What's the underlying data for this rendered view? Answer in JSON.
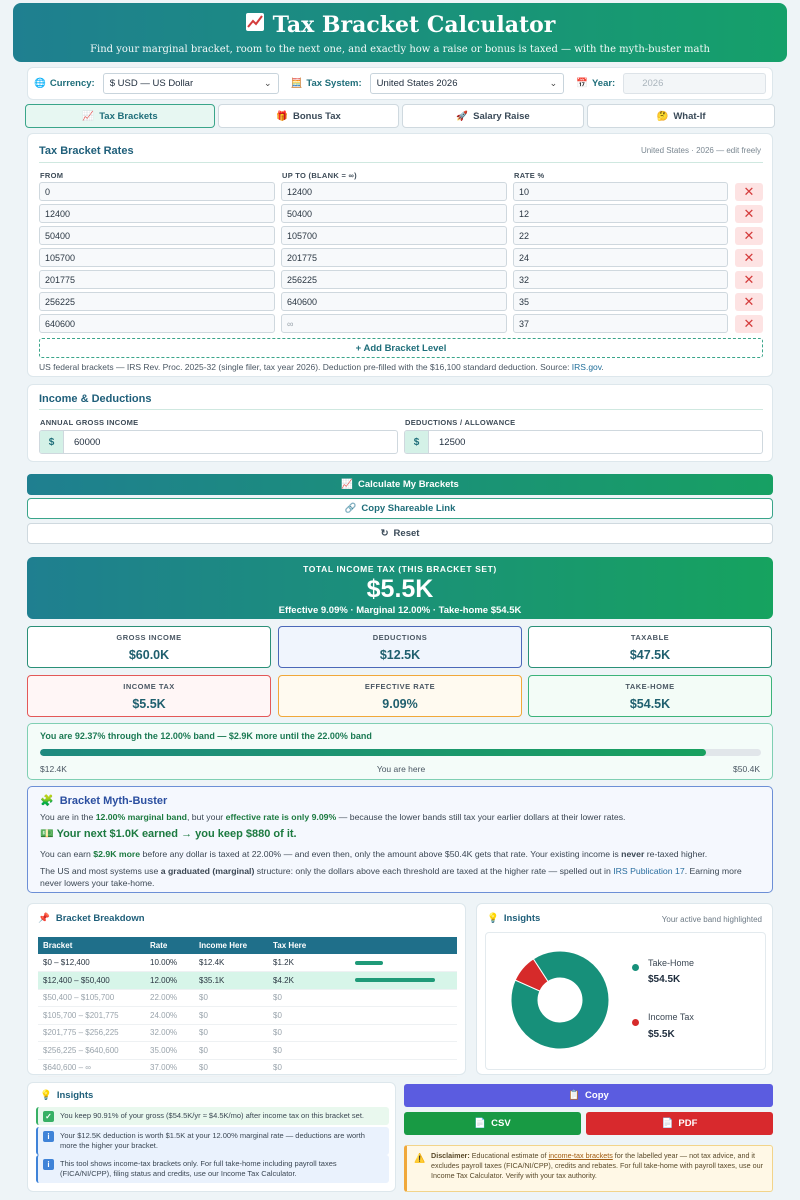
{
  "header": {
    "title": "Tax Bracket Calculator",
    "subtitle": "Find your marginal bracket, room to the next one, and exactly how a raise or bonus is taxed — with the myth-buster math"
  },
  "settings": {
    "currency_label": "Currency:",
    "currency_value": "$ USD — US Dollar",
    "tax_system_label": "Tax System:",
    "tax_system_value": "United States 2026",
    "year_label": "Year:",
    "year_value": "2026"
  },
  "tabs": [
    {
      "label": "Tax Brackets",
      "active": true
    },
    {
      "label": "Bonus Tax",
      "active": false
    },
    {
      "label": "Salary Raise",
      "active": false
    },
    {
      "label": "What-If",
      "active": false
    }
  ],
  "brackets": {
    "title": "Tax Bracket Rates",
    "meta": "United States · 2026 — edit freely",
    "col_from": "FROM",
    "col_upto": "UP TO (BLANK = ∞)",
    "col_rate": "RATE %",
    "rows": [
      {
        "from": "0",
        "upto": "12400",
        "rate": "10"
      },
      {
        "from": "12400",
        "upto": "50400",
        "rate": "12"
      },
      {
        "from": "50400",
        "upto": "105700",
        "rate": "22"
      },
      {
        "from": "105700",
        "upto": "201775",
        "rate": "24"
      },
      {
        "from": "201775",
        "upto": "256225",
        "rate": "32"
      },
      {
        "from": "256225",
        "upto": "640600",
        "rate": "35"
      },
      {
        "from": "640600",
        "upto": "",
        "rate": "37"
      }
    ],
    "upto_placeholder": "∞",
    "add_label": "+ Add Bracket Level",
    "note": "US federal brackets — IRS Rev. Proc. 2025-32 (single filer, tax year 2026). Deduction pre-filled with the $16,100 standard deduction. Source: ",
    "note_link": "IRS.gov",
    "note_end": "."
  },
  "income": {
    "title": "Income & Deductions",
    "gross_label": "ANNUAL GROSS INCOME",
    "gross_prefix": "$",
    "gross_value": "60000",
    "ded_label": "DEDUCTIONS / ALLOWANCE",
    "ded_prefix": "$",
    "ded_value": "12500"
  },
  "actions": {
    "calculate": "Calculate My Brackets",
    "copy_link": "Copy Shareable Link",
    "reset": "Reset"
  },
  "total": {
    "caption": "TOTAL INCOME TAX (THIS BRACKET SET)",
    "amount": "$5.5K",
    "line": "Effective 9.09% · Marginal 12.00% · Take-home $54.5K"
  },
  "stats": {
    "gross_label": "GROSS INCOME",
    "gross_value": "$60.0K",
    "ded_label": "DEDUCTIONS",
    "ded_value": "$12.5K",
    "taxable_label": "TAXABLE",
    "taxable_value": "$47.5K",
    "tax_label": "INCOME TAX",
    "tax_value": "$5.5K",
    "eff_label": "EFFECTIVE RATE",
    "eff_value": "9.09%",
    "home_label": "TAKE-HOME",
    "home_value": "$54.5K"
  },
  "progress": {
    "message": "You are 92.37% through the 12.00% band — $2.9K more until the 22.00% band",
    "fraction": 0.9237,
    "left": "$12.4K",
    "middle": "You are here",
    "right": "$50.4K"
  },
  "myth": {
    "title": "Bracket Myth-Buster",
    "p1_a": "You are in the ",
    "p1_b": "12.00% marginal band",
    "p1_c": ", but your ",
    "p1_d": "effective rate is only 9.09%",
    "p1_e": " — because the lower bands still tax your earlier dollars at their lower rates.",
    "big": "Your next $1.0K earned → you keep $880 of it.",
    "p2_a": "You can earn ",
    "p2_b": "$2.9K more",
    "p2_c": " before any dollar is taxed at 22.00% — and even then, only the amount above $50.4K gets that rate. Your existing income is ",
    "p2_d": "never",
    "p2_e": " re-taxed higher.",
    "p3_a": "The US and most systems use ",
    "p3_b": "a graduated (marginal)",
    "p3_c": " structure: only the dollars above each threshold are taxed at the higher rate — spelled out in ",
    "p3_d": "IRS Publication 17",
    "p3_e": ". Earning more never lowers your take-home."
  },
  "breakdown": {
    "title": "Bracket Breakdown",
    "headers": [
      "Bracket",
      "Rate",
      "Income Here",
      "Tax Here",
      ""
    ],
    "rows": [
      {
        "bracket": "$0 – $12,400",
        "rate": "10.00%",
        "income": "$12.4K",
        "tax": "$1.2K",
        "bar": 0.35,
        "state": "normal"
      },
      {
        "bracket": "$12,400 – $50,400",
        "rate": "12.00%",
        "income": "$35.1K",
        "tax": "$4.2K",
        "bar": 1.0,
        "state": "hit"
      },
      {
        "bracket": "$50,400 – $105,700",
        "rate": "22.00%",
        "income": "$0",
        "tax": "$0",
        "bar": 0,
        "state": "dim"
      },
      {
        "bracket": "$105,700 – $201,775",
        "rate": "24.00%",
        "income": "$0",
        "tax": "$0",
        "bar": 0,
        "state": "dim"
      },
      {
        "bracket": "$201,775 – $256,225",
        "rate": "32.00%",
        "income": "$0",
        "tax": "$0",
        "bar": 0,
        "state": "dim"
      },
      {
        "bracket": "$256,225 – $640,600",
        "rate": "35.00%",
        "income": "$0",
        "tax": "$0",
        "bar": 0,
        "state": "dim"
      },
      {
        "bracket": "$640,600 – ∞",
        "rate": "37.00%",
        "income": "$0",
        "tax": "$0",
        "bar": 0,
        "state": "dim"
      }
    ]
  },
  "insights_chart": {
    "title": "Insights",
    "meta": "Your active band highlighted",
    "take_home_label": "Take-Home",
    "take_home_value": "$54.5K",
    "tax_label": "Income Tax",
    "tax_value": "$5.5K",
    "colors": {
      "take_home": "#17907a",
      "tax": "#d62a2a"
    }
  },
  "chart_data": {
    "type": "pie",
    "categories": [
      "Take-Home",
      "Income Tax"
    ],
    "values": [
      54.5,
      5.5
    ],
    "title": "",
    "xlabel": "",
    "ylabel": ""
  },
  "insights_list": {
    "title": "Insights",
    "items": [
      {
        "kind": "ok",
        "text": "You keep 90.91% of your gross ($54.5K/yr ≈ $4.5K/mo) after income tax on this bracket set."
      },
      {
        "kind": "info",
        "text": "Your $12.5K deduction is worth $1.5K at your 12.00% marginal rate — deductions are worth more the higher your bracket."
      },
      {
        "kind": "info",
        "text": "This tool shows income-tax brackets only. For full take-home including payroll taxes (FICA/NI/CPP), filing status and credits, use our Income Tax Calculator."
      }
    ]
  },
  "export": {
    "copy": "Copy",
    "csv": "CSV",
    "pdf": "PDF"
  },
  "disclaimer": {
    "bold": "Disclaimer:",
    "a": " Educational estimate of ",
    "u": "income-tax brackets",
    "b": " for the labelled year — not tax advice, and it excludes payroll taxes (FICA/NI/CPP), credits and rebates. For full take-home with payroll taxes, use our Income Tax Calculator. Verify with your tax authority."
  }
}
